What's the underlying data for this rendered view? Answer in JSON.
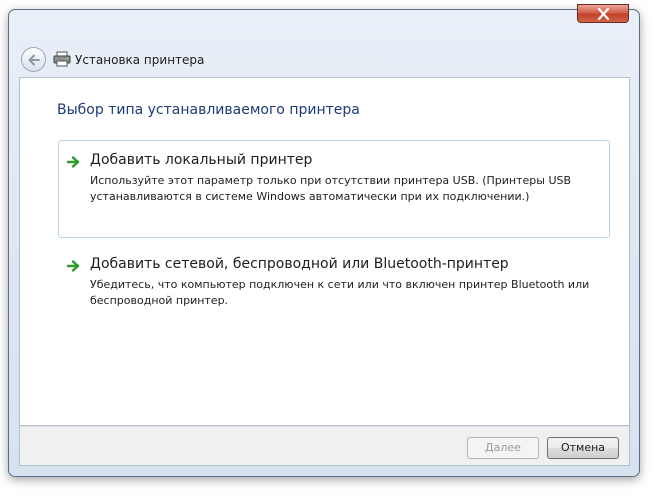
{
  "window": {
    "title": "Установка принтера",
    "icon": "printer-icon",
    "close_icon": "close-icon",
    "back_icon": "back-arrow-icon"
  },
  "main": {
    "heading": "Выбор типа устанавливаемого принтера",
    "options": [
      {
        "title": "Добавить локальный принтер",
        "description": "Используйте этот параметр только при отсутствии принтера USB. (Принтеры USB устанавливаются в системе Windows автоматически при их подключении.)",
        "icon": "green-arrow-icon"
      },
      {
        "title": "Добавить сетевой, беспроводной или Bluetooth-принтер",
        "description": "Убедитесь, что компьютер подключен к сети или что включен принтер Bluetooth или беспроводной принтер.",
        "icon": "green-arrow-icon"
      }
    ]
  },
  "footer": {
    "next_label": "Далее",
    "cancel_label": "Отмена"
  },
  "colors": {
    "heading": "#1e3a78",
    "close_button": "#c2412a",
    "arrow_green": "#2e9a2e"
  }
}
